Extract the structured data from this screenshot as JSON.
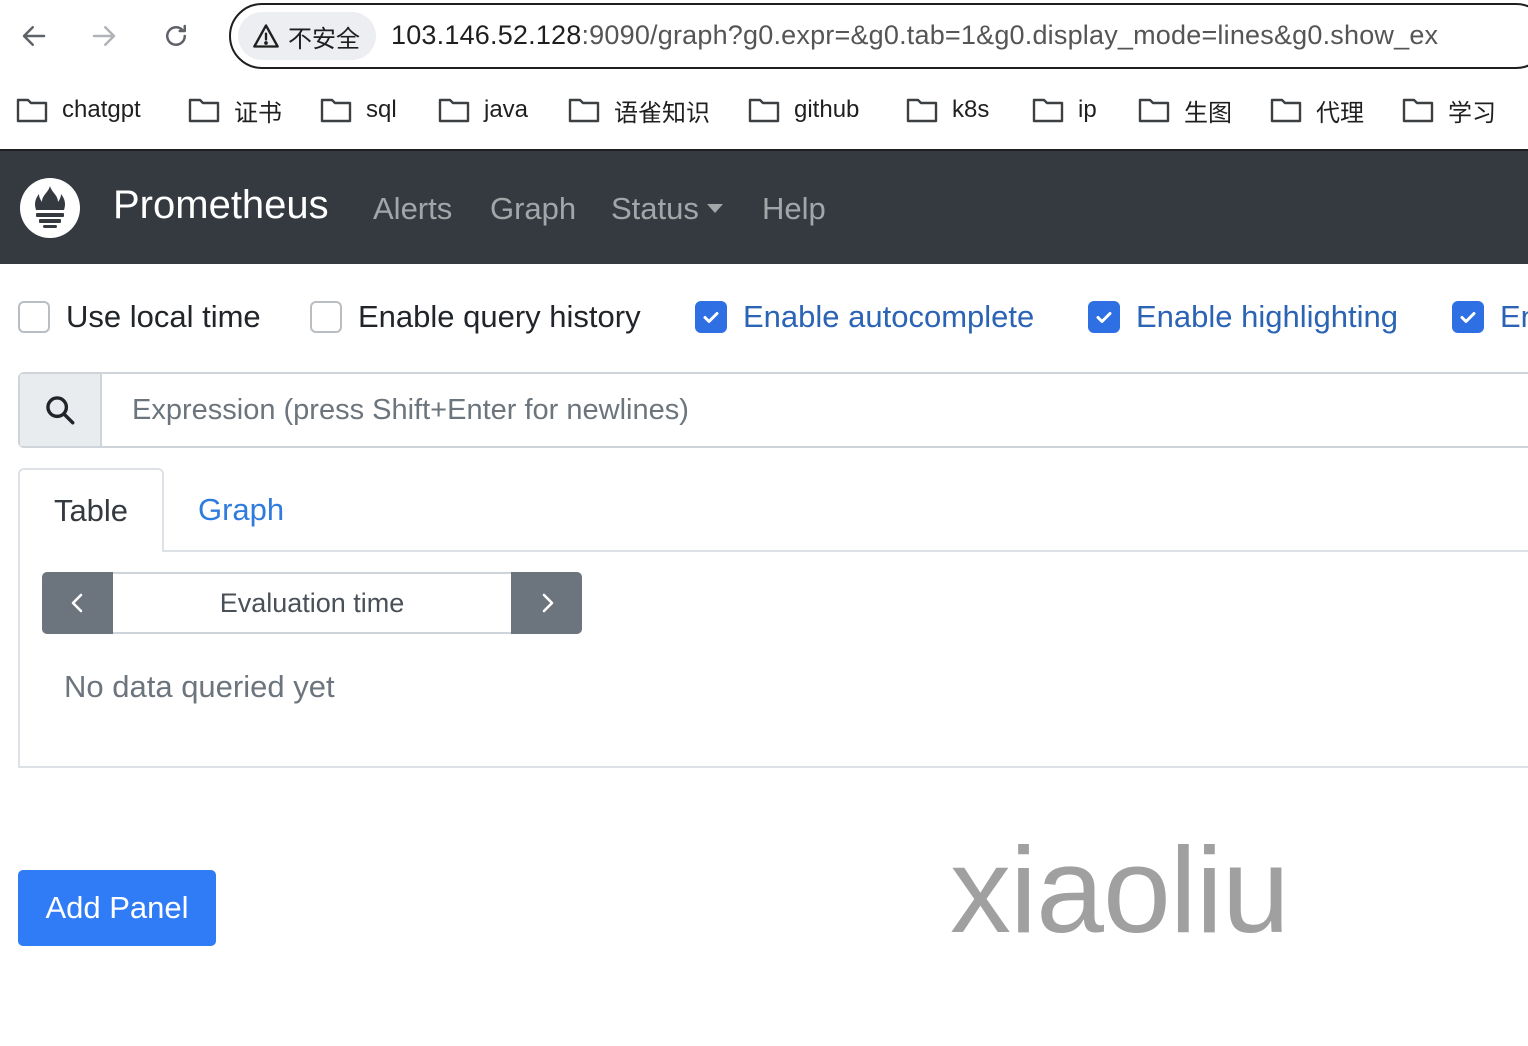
{
  "browser": {
    "security_label": "不安全",
    "url_host": "103.146.52.128",
    "url_rest": ":9090/graph?g0.expr=&g0.tab=1&g0.display_mode=lines&g0.show_ex"
  },
  "bookmarks": [
    "chatgpt",
    "证书",
    "sql",
    "java",
    "语雀知识",
    "github",
    "k8s",
    "ip",
    "生图",
    "代理",
    "学习"
  ],
  "navbar": {
    "brand": "Prometheus",
    "links": [
      "Alerts",
      "Graph",
      "Status",
      "Help"
    ]
  },
  "options": [
    {
      "label": "Use local time",
      "checked": false
    },
    {
      "label": "Enable query history",
      "checked": false
    },
    {
      "label": "Enable autocomplete",
      "checked": true
    },
    {
      "label": "Enable highlighting",
      "checked": true
    },
    {
      "label": "En",
      "checked": true
    }
  ],
  "expression": {
    "placeholder": "Expression (press Shift+Enter for newlines)"
  },
  "panel": {
    "tabs": [
      "Table",
      "Graph"
    ],
    "eval_placeholder": "Evaluation time",
    "no_data": "No data queried yet"
  },
  "add_panel_label": "Add Panel",
  "watermark": "xiaoliu",
  "colors": {
    "navbar": "#343a40",
    "primary": "#2f7cf6",
    "checkbox_checked": "#2f6fe4"
  }
}
